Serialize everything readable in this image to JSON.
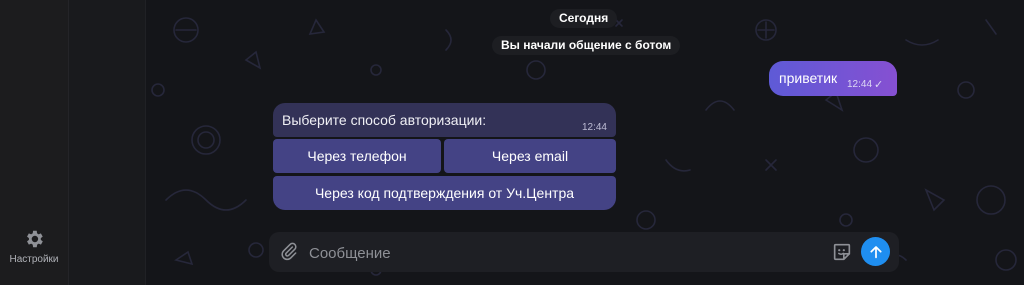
{
  "sidebar": {
    "settings_label": "Настройки",
    "settings_icon": "gear-icon"
  },
  "chat": {
    "date_label": "Сегодня",
    "service_message": "Вы начали общение с ботом",
    "outgoing": {
      "text": "приветик",
      "time": "12:44",
      "status_icon": "check-icon"
    },
    "incoming": {
      "text": "Выберите способ авторизации:",
      "time": "12:44",
      "keyboard": {
        "phone": "Через телефон",
        "email": "Через email",
        "code": "Через код подтверждения от Уч.Центра"
      }
    }
  },
  "composer": {
    "placeholder": "Сообщение",
    "attach_icon": "paperclip-icon",
    "sticker_icon": "sticker-icon",
    "send_icon": "send-arrow-icon"
  },
  "colors": {
    "outgoing_gradient_start": "#5e5ad6",
    "outgoing_gradient_end": "#8650d2",
    "keyboard_button": "#444385",
    "send_button": "#1f8ef0"
  }
}
